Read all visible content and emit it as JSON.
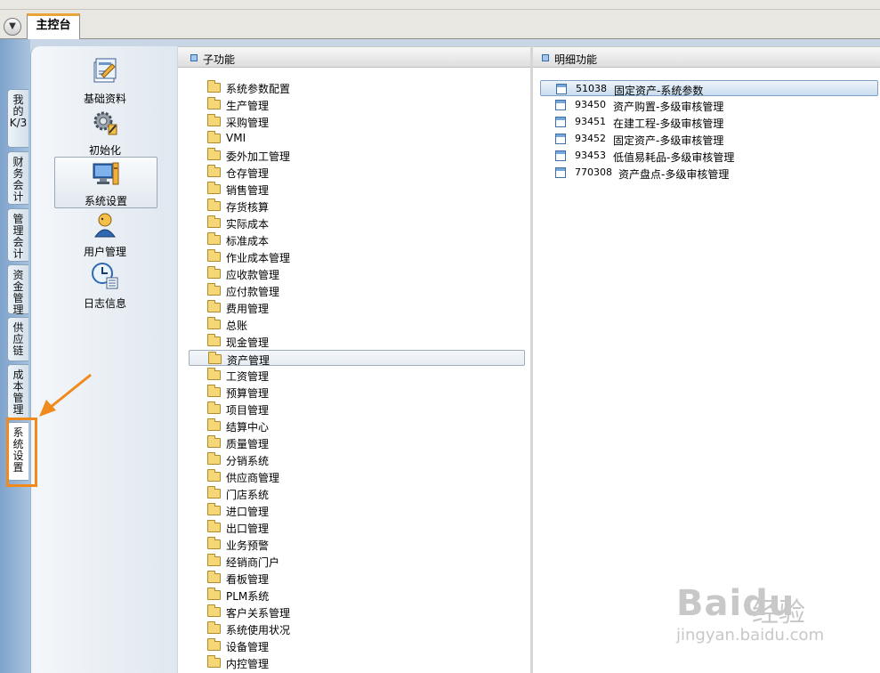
{
  "tabbar": {
    "main_tab": "主控台",
    "dropdown_icon": "dropdown-arrow-icon"
  },
  "vtabs": [
    {
      "label": "我的K/3"
    },
    {
      "label": "财务会计"
    },
    {
      "label": "管理会计"
    },
    {
      "label": "资金管理"
    },
    {
      "label": "供应链"
    },
    {
      "label": "成本管理"
    },
    {
      "label": "系统设置",
      "active": true
    }
  ],
  "nav": {
    "items": [
      {
        "label": "基础资料",
        "icon": "basic-data-icon"
      },
      {
        "label": "初始化",
        "icon": "initialize-gear-icon"
      },
      {
        "label": "系统设置",
        "icon": "system-settings-icon",
        "selected": true
      },
      {
        "label": "用户管理",
        "icon": "user-management-icon"
      },
      {
        "label": "日志信息",
        "icon": "log-info-icon"
      }
    ]
  },
  "subfunc": {
    "title": "子功能",
    "items": [
      "系统参数配置",
      "生产管理",
      "采购管理",
      "VMI",
      "委外加工管理",
      "仓存管理",
      "销售管理",
      "存货核算",
      "实际成本",
      "标准成本",
      "作业成本管理",
      "应收款管理",
      "应付款管理",
      "费用管理",
      "总账",
      "现金管理",
      "资产管理",
      "工资管理",
      "预算管理",
      "项目管理",
      "结算中心",
      "质量管理",
      "分销系统",
      "供应商管理",
      "门店系统",
      "进口管理",
      "出口管理",
      "业务预警",
      "经销商门户",
      "看板管理",
      "PLM系统",
      "客户关系管理",
      "系统使用状况",
      "设备管理",
      "内控管理"
    ],
    "selected": "资产管理"
  },
  "detail": {
    "title": "明细功能",
    "items": [
      {
        "code": "51038",
        "name": "固定资产-系统参数",
        "selected": true
      },
      {
        "code": "93450",
        "name": "资产购置-多级审核管理"
      },
      {
        "code": "93451",
        "name": "在建工程-多级审核管理"
      },
      {
        "code": "93452",
        "name": "固定资产-多级审核管理"
      },
      {
        "code": "93453",
        "name": "低值易耗品-多级审核管理"
      },
      {
        "code": "770308",
        "name": "资产盘点-多级审核管理"
      }
    ]
  },
  "annotation": {
    "color": "#f08a1c"
  },
  "watermark": {
    "logo": "Baidu",
    "text": "经验",
    "url": "jingyan.baidu.com"
  }
}
